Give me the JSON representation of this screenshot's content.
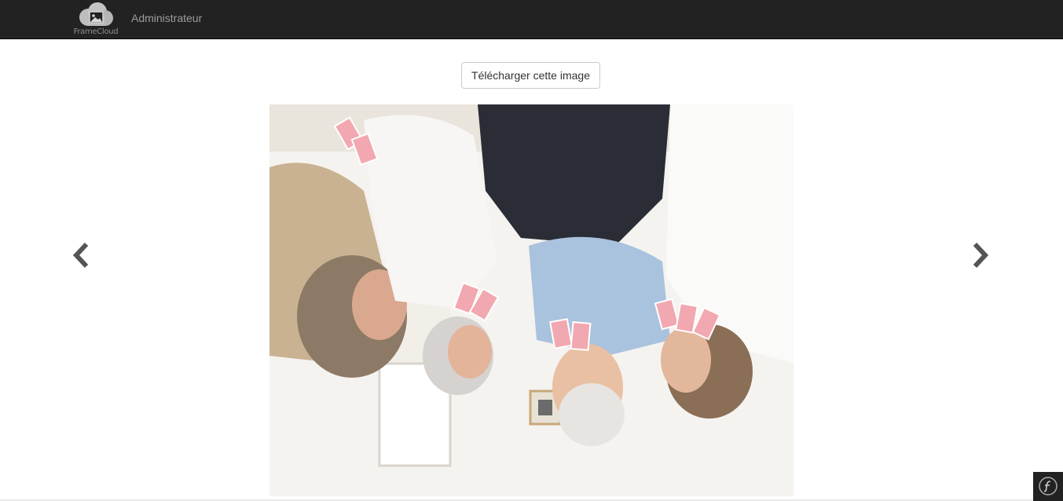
{
  "navbar": {
    "brand_text": "FrameCloud",
    "brand_icon": "cloud-picture-icon",
    "user_link": "Administrateur"
  },
  "main": {
    "download_label": "Télécharger cette image",
    "prev_icon": "chevron-left-icon",
    "next_icon": "chevron-right-icon"
  },
  "toolbar": {
    "icon": "symfony-icon"
  },
  "colors": {
    "navbar_bg": "#222222",
    "nav_text": "#9d9d9d",
    "arrow": "#555555"
  }
}
